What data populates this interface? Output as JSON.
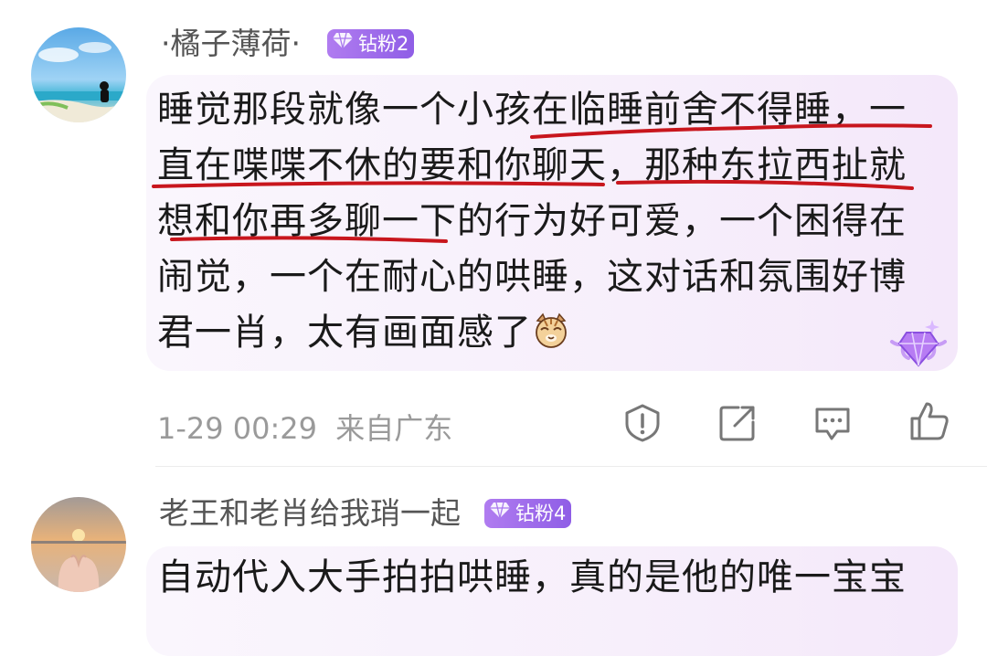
{
  "comments": [
    {
      "username": "·橘子薄荷·",
      "badge": "钻粉2",
      "text": "睡觉那段就像一个小孩在临睡前舍不得睡，一直在喋喋不休的要和你聊天，那种东拉西扯就想和你再多聊一下的行为好可爱，一个困得在闹觉，一个在耐心的哄睡，这对话和氛围好博君一肖，太有画面感了",
      "emoji": "cat-emoji",
      "timestamp": "1-29 00:29",
      "location": "来自广东",
      "actions": [
        "report-icon",
        "share-icon",
        "comment-icon",
        "like-icon"
      ]
    },
    {
      "username": "老王和老肖给我琑一起",
      "badge": "钻粉4",
      "text": "自动代入大手拍拍哄睡，真的是他的唯一宝宝"
    }
  ],
  "colors": {
    "badge": "#9b6ae8",
    "underline": "#c8161d",
    "meta": "#9a9a9a"
  }
}
